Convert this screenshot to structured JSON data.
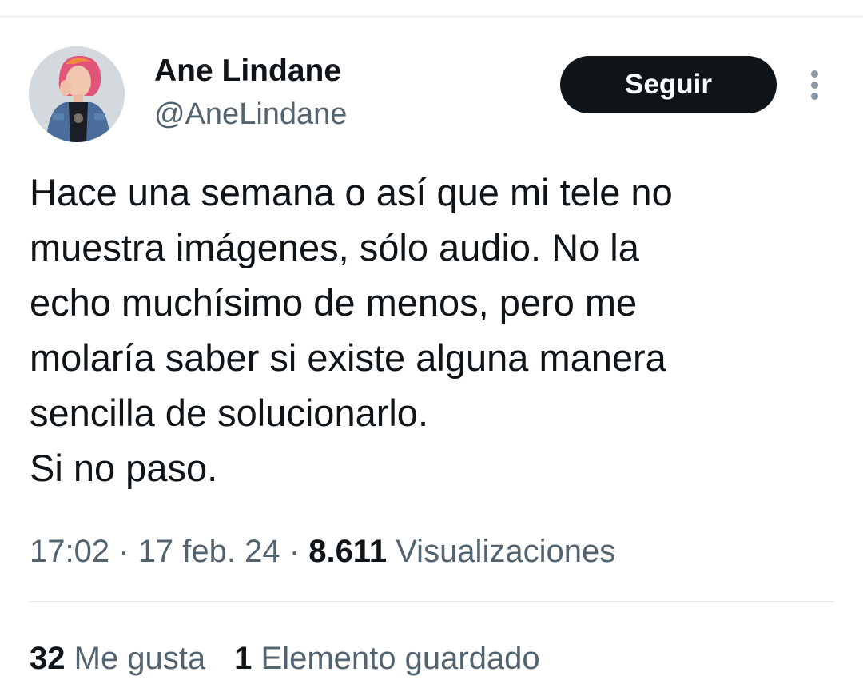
{
  "user": {
    "display_name": "Ane Lindane",
    "handle": "@AneLindane",
    "avatar_icon": "user-avatar"
  },
  "follow_button": {
    "label": "Seguir",
    "bg": "#0f1419",
    "color": "#ffffff"
  },
  "more_icon": "vertical-ellipsis-icon",
  "tweet": {
    "lines": [
      "Hace una semana o así que mi tele no",
      "muestra imágenes, sólo audio. No la",
      "echo muchísimo de menos, pero me",
      "molaría saber si existe alguna manera",
      "sencilla de solucionarlo.",
      "Si no paso."
    ]
  },
  "meta": {
    "time": "17:02",
    "separator": "·",
    "date": "17 feb. 24",
    "views_count": "8.611",
    "views_label": "Visualizaciones"
  },
  "stats": {
    "likes_count": "32",
    "likes_label": "Me gusta",
    "bookmarks_count": "1",
    "bookmarks_label": "Elemento guardado"
  },
  "colors": {
    "text_primary": "#0f1419",
    "text_secondary": "#536471",
    "divider": "#e6e9ec"
  }
}
